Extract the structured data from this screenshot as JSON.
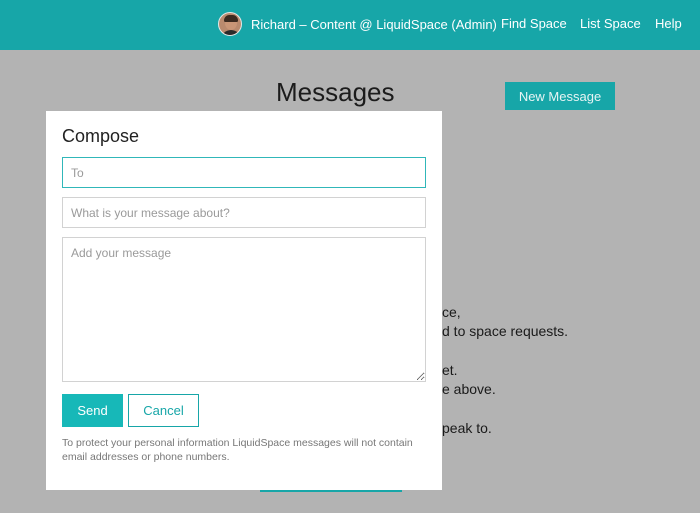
{
  "header": {
    "user_label": "Richard – Content @ LiquidSpace (Admin)",
    "nav": [
      "Find Space",
      "List Space",
      "Help"
    ]
  },
  "page": {
    "title": "Messages",
    "new_message_label": "New Message",
    "background_lines": [
      "ce,",
      "d to space requests.",
      "et.",
      "e above.",
      "peak to."
    ]
  },
  "compose": {
    "title": "Compose",
    "to_placeholder": "To",
    "subject_placeholder": "What is your message about?",
    "message_placeholder": "Add your message",
    "send_label": "Send",
    "cancel_label": "Cancel",
    "privacy_note": "To protect your personal information LiquidSpace messages will not contain email addresses or phone numbers."
  },
  "colors": {
    "brand": "#17a6a8",
    "overlay": "#b3b3b3"
  }
}
